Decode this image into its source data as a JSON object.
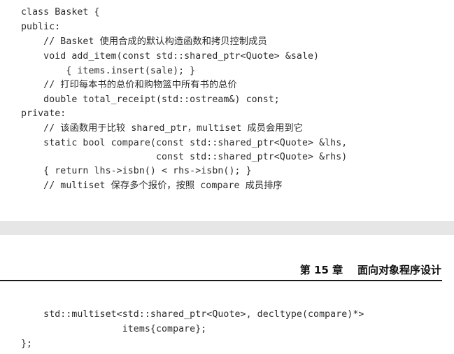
{
  "top_code": [
    "class Basket {",
    "public:",
    "    // Basket 使用合成的默认构造函数和拷贝控制成员",
    "    void add_item(const std::shared_ptr<Quote> &sale)",
    "        { items.insert(sale); }",
    "    // 打印每本书的总价和购物篮中所有书的总价",
    "    double total_receipt(std::ostream&) const;",
    "private:",
    "    // 该函数用于比较 shared_ptr，multiset 成员会用到它",
    "    static bool compare(const std::shared_ptr<Quote> &lhs,",
    "                        const std::shared_ptr<Quote> &rhs)",
    "    { return lhs->isbn() < rhs->isbn(); }",
    "    // multiset 保存多个报价，按照 compare 成员排序"
  ],
  "chapter_header": {
    "label": "第 15 章    面向对象程序设计"
  },
  "bottom_code": [
    "    std::multiset<std::shared_ptr<Quote>, decltype(compare)*>",
    "                  items{compare};",
    "};"
  ]
}
